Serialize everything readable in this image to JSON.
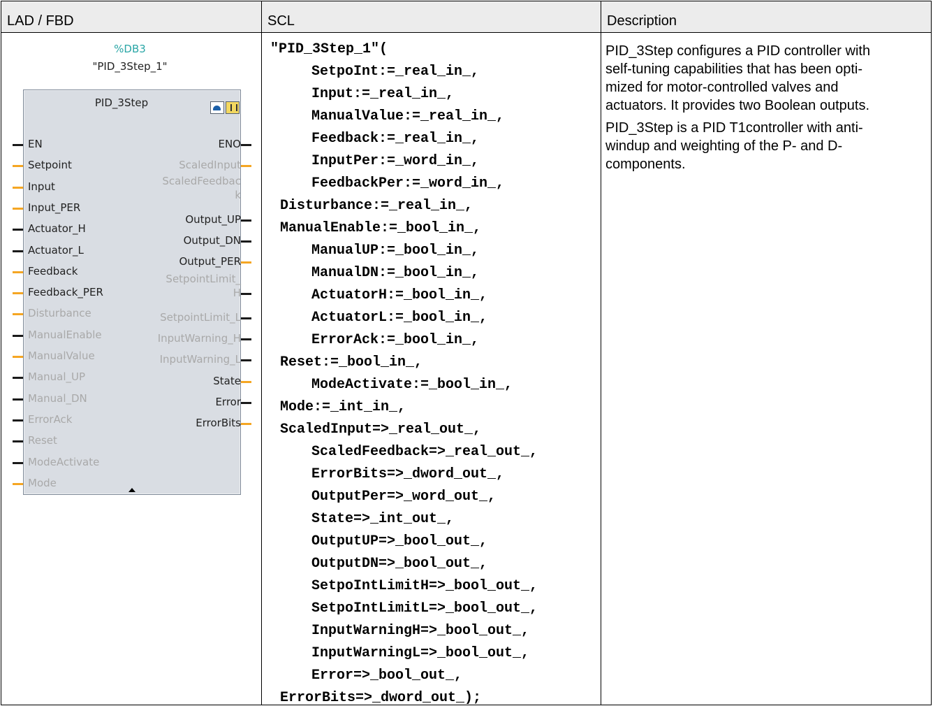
{
  "headers": {
    "lad_fbd": "LAD / FBD",
    "scl": "SCL",
    "description": "Description"
  },
  "block": {
    "db_number": "%DB3",
    "instance_name": "\"PID_3Step_1\"",
    "type_name": "PID_3Step",
    "icons": [
      "dial-icon",
      "warning-icon"
    ],
    "inputs": [
      {
        "label": "EN",
        "kind": "bool",
        "dim": false
      },
      {
        "label": "Setpoint",
        "kind": "num",
        "dim": false
      },
      {
        "label": "Input",
        "kind": "num",
        "dim": false
      },
      {
        "label": "Input_PER",
        "kind": "num",
        "dim": false
      },
      {
        "label": "Actuator_H",
        "kind": "bool",
        "dim": false
      },
      {
        "label": "Actuator_L",
        "kind": "bool",
        "dim": false
      },
      {
        "label": "Feedback",
        "kind": "num",
        "dim": false
      },
      {
        "label": "Feedback_PER",
        "kind": "num",
        "dim": false
      },
      {
        "label": "Disturbance",
        "kind": "num",
        "dim": true
      },
      {
        "label": "ManualEnable",
        "kind": "bool",
        "dim": true
      },
      {
        "label": "ManualValue",
        "kind": "num",
        "dim": true
      },
      {
        "label": "Manual_UP",
        "kind": "bool",
        "dim": true
      },
      {
        "label": "Manual_DN",
        "kind": "bool",
        "dim": true
      },
      {
        "label": "ErrorAck",
        "kind": "bool",
        "dim": true
      },
      {
        "label": "Reset",
        "kind": "bool",
        "dim": true
      },
      {
        "label": "ModeActivate",
        "kind": "bool",
        "dim": true
      },
      {
        "label": "Mode",
        "kind": "num",
        "dim": true
      }
    ],
    "outputs": [
      {
        "label": "ENO",
        "kind": "bool",
        "dim": false
      },
      {
        "label": "ScaledInput",
        "kind": "num",
        "dim": true
      },
      {
        "label": "ScaledFeedbac",
        "kind": "none",
        "dim": true
      },
      {
        "label": "k",
        "kind": "none",
        "dim": true
      },
      {
        "label": "Output_UP",
        "kind": "bool",
        "dim": false
      },
      {
        "label": "Output_DN",
        "kind": "bool",
        "dim": false
      },
      {
        "label": "Output_PER",
        "kind": "num",
        "dim": false
      },
      {
        "label": "SetpointLimit_",
        "kind": "none",
        "dim": true
      },
      {
        "label": "H",
        "kind": "bool",
        "dim": true
      },
      {
        "label": "SetpointLimit_L",
        "kind": "bool",
        "dim": true
      },
      {
        "label": "InputWarning_H",
        "kind": "bool",
        "dim": true
      },
      {
        "label": "InputWarning_L",
        "kind": "bool",
        "dim": true
      },
      {
        "label": "State",
        "kind": "num",
        "dim": false
      },
      {
        "label": "Error",
        "kind": "bool",
        "dim": false
      },
      {
        "label": "ErrorBits",
        "kind": "num",
        "dim": false
      }
    ]
  },
  "scl": [
    {
      "text": "\"PID_3Step_1\"(",
      "indent": 0
    },
    {
      "text": "SetpoInt:=_real_in_,",
      "indent": 2
    },
    {
      "text": "Input:=_real_in_,",
      "indent": 2
    },
    {
      "text": "ManualValue:=_real_in_,",
      "indent": 2
    },
    {
      "text": "Feedback:=_real_in_,",
      "indent": 2
    },
    {
      "text": "InputPer:=_word_in_,",
      "indent": 2
    },
    {
      "text": "FeedbackPer:=_word_in_,",
      "indent": 2
    },
    {
      "text": "Disturbance:=_real_in_,",
      "indent": 1
    },
    {
      "text": "ManualEnable:=_bool_in_,",
      "indent": 1
    },
    {
      "text": "ManualUP:=_bool_in_,",
      "indent": 2
    },
    {
      "text": "ManualDN:=_bool_in_,",
      "indent": 2
    },
    {
      "text": "ActuatorH:=_bool_in_,",
      "indent": 2
    },
    {
      "text": "ActuatorL:=_bool_in_,",
      "indent": 2
    },
    {
      "text": "ErrorAck:=_bool_in_,",
      "indent": 2
    },
    {
      "text": "Reset:=_bool_in_,",
      "indent": 1
    },
    {
      "text": "ModeActivate:=_bool_in_,",
      "indent": 2
    },
    {
      "text": "Mode:=_int_in_,",
      "indent": 1
    },
    {
      "text": "ScaledInput=>_real_out_,",
      "indent": 1
    },
    {
      "text": "ScaledFeedback=>_real_out_,",
      "indent": 2
    },
    {
      "text": "ErrorBits=>_dword_out_,",
      "indent": 2
    },
    {
      "text": "OutputPer=>_word_out_,",
      "indent": 2
    },
    {
      "text": "State=>_int_out_,",
      "indent": 2
    },
    {
      "text": "OutputUP=>_bool_out_,",
      "indent": 2
    },
    {
      "text": "OutputDN=>_bool_out_,",
      "indent": 2
    },
    {
      "text": "SetpoIntLimitH=>_bool_out_,",
      "indent": 2
    },
    {
      "text": "SetpoIntLimitL=>_bool_out_,",
      "indent": 2
    },
    {
      "text": "InputWarningH=>_bool_out_,",
      "indent": 2
    },
    {
      "text": "InputWarningL=>_bool_out_,",
      "indent": 2
    },
    {
      "text": "Error=>_bool_out_,",
      "indent": 2
    },
    {
      "text": "ErrorBits=>_dword_out_);",
      "indent": 1
    }
  ],
  "description": {
    "lines_p1": [
      "PID_3Step configures a PID controller with",
      "self-tuning capabilities that has been opti-",
      "mized for motor-controlled valves and",
      "actuators. It provides two Boolean outputs."
    ],
    "lines_p2": [
      "PID_3Step is a PID T1controller with anti-",
      "windup and weighting of the P- and D-",
      "components."
    ]
  }
}
